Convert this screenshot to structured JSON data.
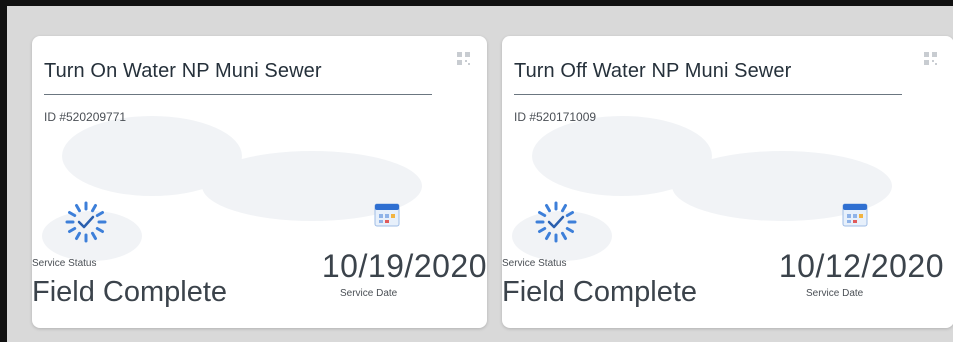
{
  "colors": {
    "frame": "#111111",
    "background": "#d9d9d9",
    "card": "#ffffff",
    "title": "#26313b",
    "status_icon": "#3d7fd9",
    "calendar_header": "#2f6fd1"
  },
  "cards": [
    {
      "title": "Turn On Water NP Muni Sewer",
      "id": "ID #520209771",
      "status_label": "Service Status",
      "status_value": "Field Complete",
      "date_value": "10/19/2020",
      "date_label": "Service Date",
      "icons": [
        "qr-code-icon",
        "service-status-icon",
        "calendar-icon"
      ]
    },
    {
      "title": "Turn Off Water NP Muni Sewer",
      "id": "ID #520171009",
      "status_label": "Service Status",
      "status_value": "Field Complete",
      "date_value": "10/12/2020",
      "date_label": "Service Date",
      "icons": [
        "qr-code-icon",
        "service-status-icon",
        "calendar-icon"
      ]
    }
  ]
}
